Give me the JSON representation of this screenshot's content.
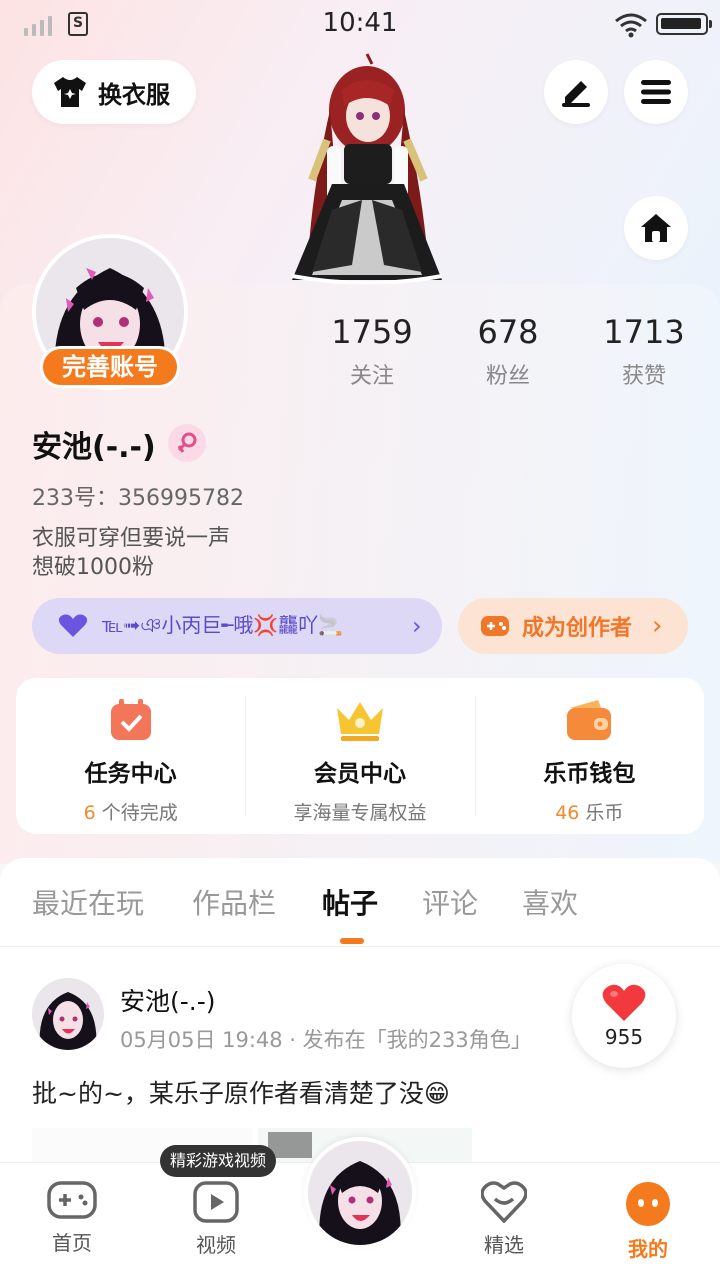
{
  "status_bar": {
    "time": "10:41"
  },
  "header": {
    "outfit_label": "换衣服",
    "edit_icon": "pen-icon",
    "menu_icon": "menu-icon",
    "home_icon": "home-icon"
  },
  "profile": {
    "complete_account_label": "完善账号",
    "username": "安池(-.-)",
    "uid_text": "233号：356995782",
    "bio_line1": "衣服可穿但要说一声",
    "bio_line2": "想破1000粉",
    "stats": [
      {
        "value": "1759",
        "label": "关注"
      },
      {
        "value": "678",
        "label": "粉丝"
      },
      {
        "value": "1713",
        "label": "获赞"
      }
    ],
    "family_text": "℡➟ঞ小丙巨╾哦💢龘吖🚬",
    "creator_label": "成为创作者"
  },
  "services": [
    {
      "title": "任务中心",
      "sub_highlight": "6",
      "sub_text": " 个待完成",
      "icon": "calendar-check-icon"
    },
    {
      "title": "会员中心",
      "sub_highlight": "",
      "sub_text": "享海量专属权益",
      "icon": "crown-icon"
    },
    {
      "title": "乐币钱包",
      "sub_highlight": "46",
      "sub_text": " 乐币",
      "icon": "wallet-icon"
    }
  ],
  "tabs": [
    {
      "label": "最近在玩",
      "active": false
    },
    {
      "label": "作品栏",
      "active": false
    },
    {
      "label": "帖子",
      "active": true
    },
    {
      "label": "评论",
      "active": false
    },
    {
      "label": "喜欢",
      "active": false
    }
  ],
  "post": {
    "author": "安池(-.-)",
    "meta": "05月05日 19:48 · 发布在「我的233角色」",
    "text": "批~的~，某乐子原作者看清楚了没😁",
    "like_count": "955"
  },
  "bottom_nav": {
    "tooltip": "精彩游戏视频",
    "items": [
      {
        "label": "首页",
        "icon": "gamepad-icon",
        "active": false
      },
      {
        "label": "视频",
        "icon": "video-icon",
        "active": false
      },
      {
        "label": "精选",
        "icon": "featured-icon",
        "active": false
      },
      {
        "label": "我的",
        "icon": "profile-face-icon",
        "active": true
      }
    ]
  },
  "colors": {
    "accent": "#f57a1e",
    "family_purple": "#5a4bc8"
  }
}
